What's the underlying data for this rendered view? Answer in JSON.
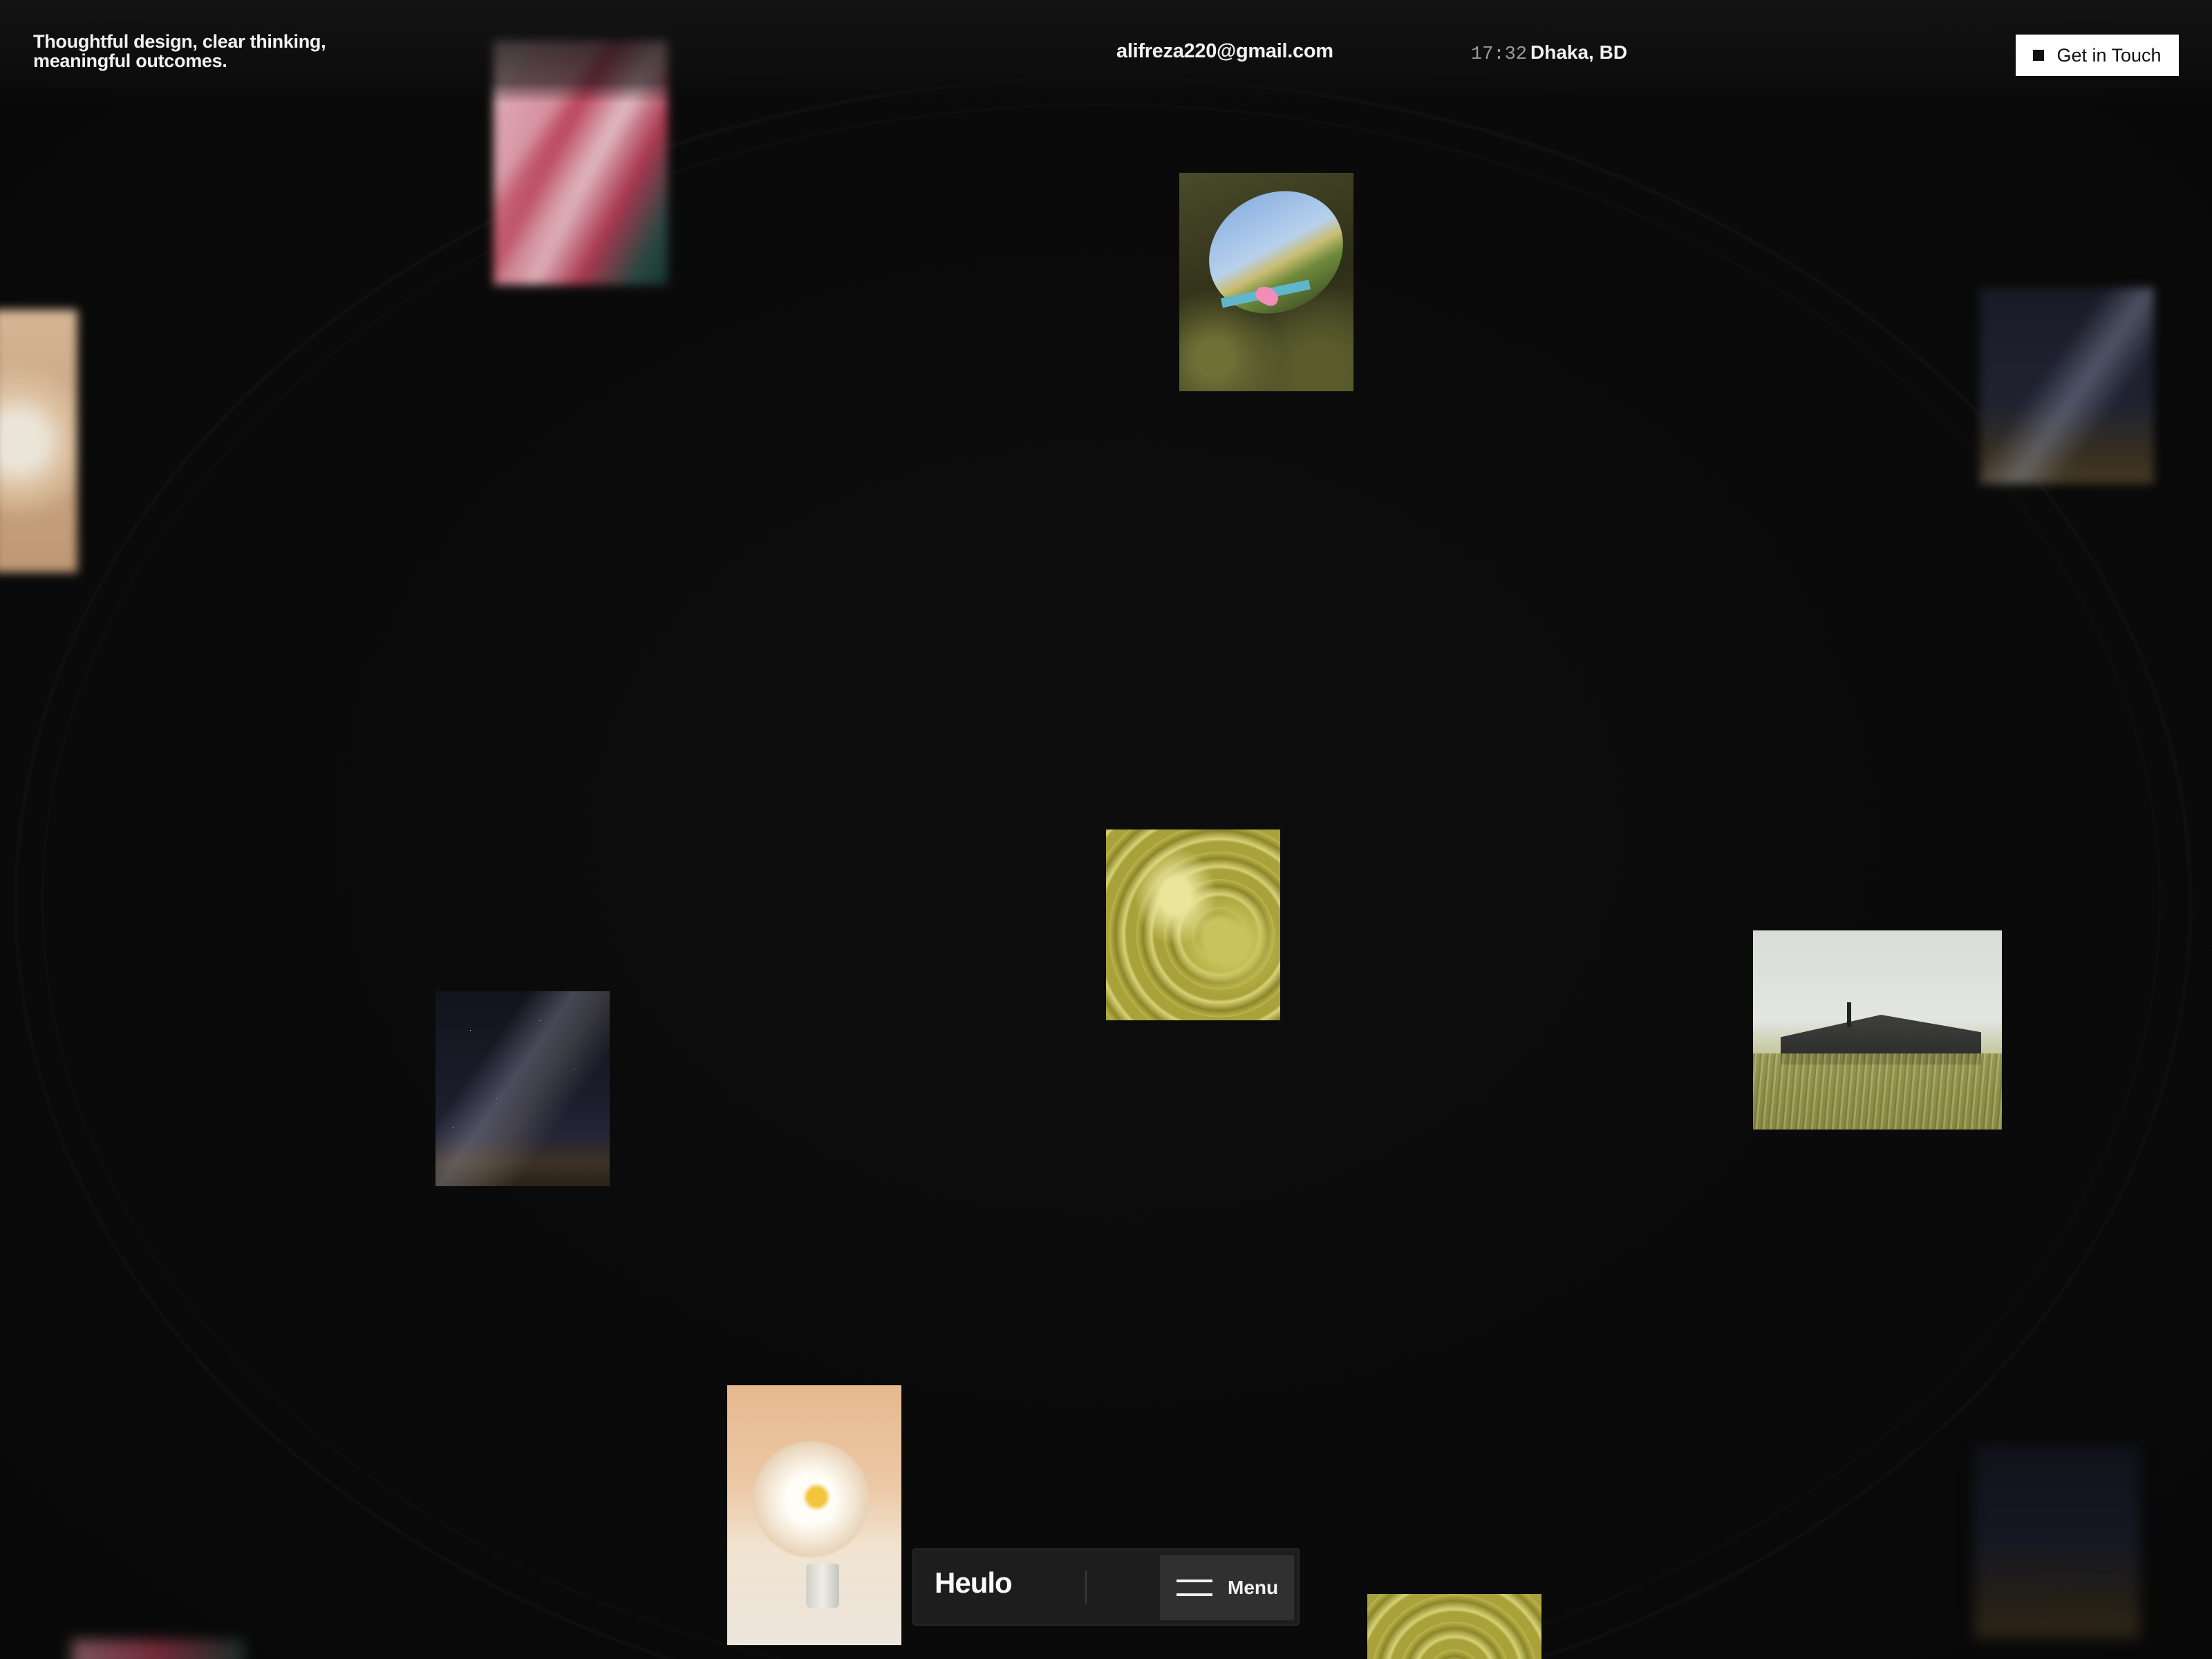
{
  "header": {
    "tagline_line1": "Thoughtful design, clear thinking,",
    "tagline_line2": "meaningful outcomes.",
    "email": "alifreza220@gmail.com",
    "time": "17:32",
    "location": "Dhaka, BD",
    "cta_label": "Get in Touch"
  },
  "gallery": {
    "tiles": [
      {
        "name": "pink-motion-blur"
      },
      {
        "name": "peony-flower-left-edge"
      },
      {
        "name": "cave-opening-flamingo"
      },
      {
        "name": "night-sky-right"
      },
      {
        "name": "green-pesto-swirl"
      },
      {
        "name": "milky-way-rocks"
      },
      {
        "name": "dark-house-in-grass"
      },
      {
        "name": "white-peony-vase"
      },
      {
        "name": "green-pesto-swirl-bottom"
      }
    ]
  },
  "dock": {
    "brand": "Heulo",
    "menu_label": "Menu"
  },
  "icons": {
    "cta": "square-icon",
    "menu": "hamburger-icon"
  },
  "colors": {
    "background": "#0a0a0a",
    "dock": "#1d1d1d",
    "menu_button": "#303030",
    "cta_bg": "#ffffff"
  }
}
